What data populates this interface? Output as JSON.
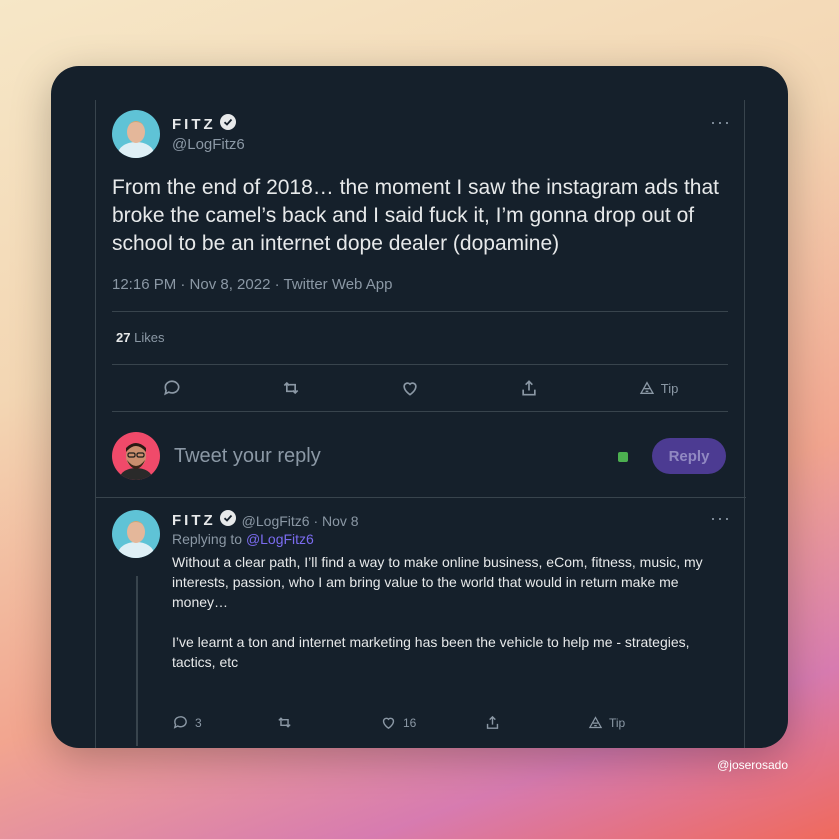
{
  "tweet": {
    "author_name": "FITZ",
    "author_handle": "@LogFitz6",
    "text": "From the end of 2018… the moment I saw the instagram ads that broke the camel’s back and I said fuck it, I’m gonna drop out of school to be an internet dope dealer (dopamine)",
    "meta": "12:16 PM · Nov 8, 2022 · Twitter Web App",
    "likes_count": "27",
    "likes_label": "Likes",
    "tip_label": "Tip",
    "more_label": "···"
  },
  "reply_box": {
    "placeholder": "Tweet your reply",
    "button_label": "Reply"
  },
  "reply_tweet": {
    "author_name": "FITZ",
    "author_handle_date": "@LogFitz6 · Nov 8",
    "replying_prefix": "Replying to",
    "replying_to": "@LogFitz6",
    "paragraph1": "Without a clear path, I’ll find a way to make online business, eCom, fitness, music, my interests, passion, who I am bring value to the world that would in return make me money…",
    "paragraph2": "I’ve learnt a ton and internet marketing has been the vehicle to help me - strategies, tactics, etc",
    "reply_count": "3",
    "like_count": "16",
    "tip_label": "Tip",
    "more_label": "···"
  },
  "watermark": "@joserosado",
  "colors": {
    "background": "#15202b",
    "accent": "#7b6cf0",
    "reply_button": "#4c3b92",
    "verified": "#e7e9ea"
  },
  "icons": [
    "comment-icon",
    "retweet-icon",
    "heart-icon",
    "share-icon",
    "tip-icon",
    "verified-icon",
    "more-icon"
  ]
}
